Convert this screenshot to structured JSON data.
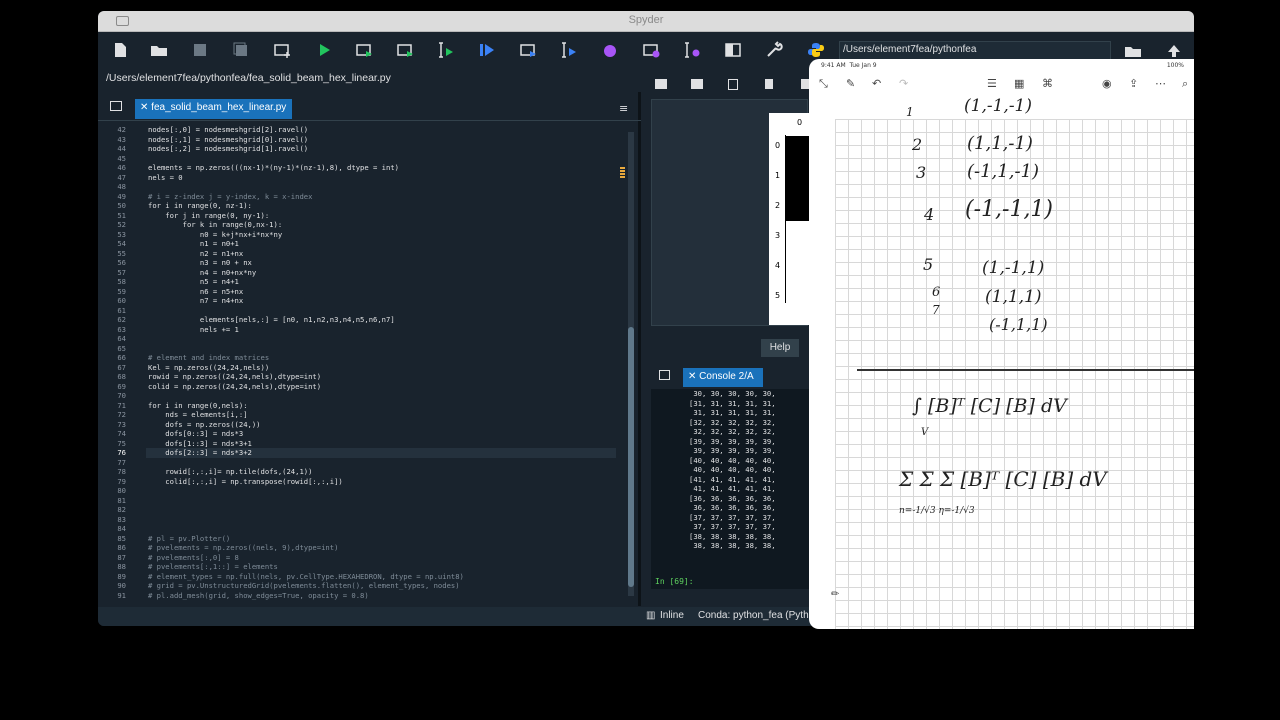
{
  "window": {
    "title": "Spyder"
  },
  "toolbar": {
    "icons": [
      "new-file-icon",
      "open-file-icon",
      "save-icon",
      "save-all-icon",
      "new-cell-icon",
      "run-icon",
      "run-cell-icon",
      "run-cell-advance-icon",
      "run-selection-icon",
      "debug-icon",
      "debug-cell-icon",
      "step-icon",
      "continue-icon",
      "stop-icon",
      "maximize-icon",
      "preferences-icon",
      "python-icon"
    ],
    "working_dir": "/Users/element7fea/pythonfea"
  },
  "editor": {
    "file_path": "/Users/element7fea/pythonfea/fea_solid_beam_hex_linear.py",
    "tab_close": "✕",
    "tab_label": "fea_solid_beam_hex_linear.py",
    "current_line": 76,
    "lines": [
      {
        "n": 42,
        "t": "nodes[:,0] = nodesmeshgrid[2].ravel()"
      },
      {
        "n": 43,
        "t": "nodes[:,1] = nodesmeshgrid[0].ravel()"
      },
      {
        "n": 44,
        "t": "nodes[:,2] = nodesmeshgrid[1].ravel()"
      },
      {
        "n": 45,
        "t": ""
      },
      {
        "n": 46,
        "t": "elements = np.zeros(((nx-1)*(ny-1)*(nz-1),8), dtype = int)"
      },
      {
        "n": 47,
        "t": "nels = 0"
      },
      {
        "n": 48,
        "t": ""
      },
      {
        "n": 49,
        "t": "# i = z-index j = y-index, k = x-index"
      },
      {
        "n": 50,
        "t": "for i in range(0, nz-1):"
      },
      {
        "n": 51,
        "t": "    for j in range(0, ny-1):"
      },
      {
        "n": 52,
        "t": "        for k in range(0,nx-1):"
      },
      {
        "n": 53,
        "t": "            n0 = k+j*nx+i*nx*ny"
      },
      {
        "n": 54,
        "t": "            n1 = n0+1"
      },
      {
        "n": 55,
        "t": "            n2 = n1+nx"
      },
      {
        "n": 56,
        "t": "            n3 = n0 + nx"
      },
      {
        "n": 57,
        "t": "            n4 = n0+nx*ny"
      },
      {
        "n": 58,
        "t": "            n5 = n4+1"
      },
      {
        "n": 59,
        "t": "            n6 = n5+nx"
      },
      {
        "n": 60,
        "t": "            n7 = n4+nx"
      },
      {
        "n": 61,
        "t": ""
      },
      {
        "n": 62,
        "t": "            elements[nels,:] = [n0, n1,n2,n3,n4,n5,n6,n7]"
      },
      {
        "n": 63,
        "t": "            nels += 1"
      },
      {
        "n": 64,
        "t": ""
      },
      {
        "n": 65,
        "t": ""
      },
      {
        "n": 66,
        "t": "# element and index matrices"
      },
      {
        "n": 67,
        "t": "Kel = np.zeros((24,24,nels))"
      },
      {
        "n": 68,
        "t": "rowid = np.zeros((24,24,nels),dtype=int)"
      },
      {
        "n": 69,
        "t": "colid = np.zeros((24,24,nels),dtype=int)"
      },
      {
        "n": 70,
        "t": ""
      },
      {
        "n": 71,
        "t": "for i in range(0,nels):"
      },
      {
        "n": 72,
        "t": "    nds = elements[i,:]"
      },
      {
        "n": 73,
        "t": "    dofs = np.zeros((24,))"
      },
      {
        "n": 74,
        "t": "    dofs[0::3] = nds*3"
      },
      {
        "n": 75,
        "t": "    dofs[1::3] = nds*3+1"
      },
      {
        "n": 76,
        "t": "    dofs[2::3] = nds*3+2"
      },
      {
        "n": 77,
        "t": ""
      },
      {
        "n": 78,
        "t": "    rowid[:,:,i]= np.tile(dofs,(24,1))"
      },
      {
        "n": 79,
        "t": "    colid[:,:,i] = np.transpose(rowid[:,:,i])"
      },
      {
        "n": 80,
        "t": ""
      },
      {
        "n": 81,
        "t": ""
      },
      {
        "n": 82,
        "t": ""
      },
      {
        "n": 83,
        "t": ""
      },
      {
        "n": 84,
        "t": ""
      },
      {
        "n": 85,
        "t": "# pl = pv.Plotter()"
      },
      {
        "n": 86,
        "t": "# pvelements = np.zeros((nels, 9),dtype=int)"
      },
      {
        "n": 87,
        "t": "# pvelements[:,0] = 8"
      },
      {
        "n": 88,
        "t": "# pvelements[:,1::] = elements"
      },
      {
        "n": 89,
        "t": "# element_types = np.full(nels, pv.CellType.HEXAHEDRON, dtype = np.uint8)"
      },
      {
        "n": 90,
        "t": "# grid = pv.UnstructuredGrid(pvelements.flatten(), element_types, nodes)"
      },
      {
        "n": 91,
        "t": "# pl.add_mesh(grid, show_edges=True, opacity = 0.8)"
      }
    ]
  },
  "plots": {
    "y_ticks": [
      "0",
      "1",
      "2",
      "3",
      "4",
      "5"
    ],
    "x_tick": "0",
    "help_label": "Help"
  },
  "console": {
    "tab_close": "✕",
    "tab_label": "Console 2/A",
    "output": [
      " 30, 30, 30, 30, 30,",
      "[31, 31, 31, 31, 31,",
      " 31, 31, 31, 31, 31,",
      "[32, 32, 32, 32, 32,",
      " 32, 32, 32, 32, 32,",
      "[39, 39, 39, 39, 39,",
      " 39, 39, 39, 39, 39,",
      "[40, 40, 40, 40, 40,",
      " 40, 40, 40, 40, 40,",
      "[41, 41, 41, 41, 41,",
      " 41, 41, 41, 41, 41,",
      "[36, 36, 36, 36, 36,",
      " 36, 36, 36, 36, 36,",
      "[37, 37, 37, 37, 37,",
      " 37, 37, 37, 37, 37,",
      "[38, 38, 38, 38, 38,",
      " 38, 38, 38, 38, 38,"
    ],
    "prompt": "In [69]:"
  },
  "statusbar": {
    "inline": "Inline",
    "conda": "Conda: python_fea (Pyth"
  },
  "ipad": {
    "time": "9:41 AM",
    "date": "Tue Jan 9",
    "battery": "100%",
    "notes": {
      "row0": "(1,-1,-1)",
      "n1": "1",
      "n2": "2",
      "row2": "(1,1,-1)",
      "n3": "3",
      "row3": "(-1,1,-1)",
      "n4": "4",
      "row4": "(-1,-1,1)",
      "n5": "5",
      "row5": "(1,-1,1)",
      "n6": "6",
      "row6": "(1,1,1)",
      "n7": "7",
      "row7": "(-1,1,1)",
      "integral": "∫ [B]ᵀ [C] [B] dV",
      "integral_sub": "V",
      "sum": "Σ  Σ  Σ  [B]ᵀ [C] [B] dV",
      "sum_sub": "n=-1/√3  η=-1/√3"
    }
  }
}
